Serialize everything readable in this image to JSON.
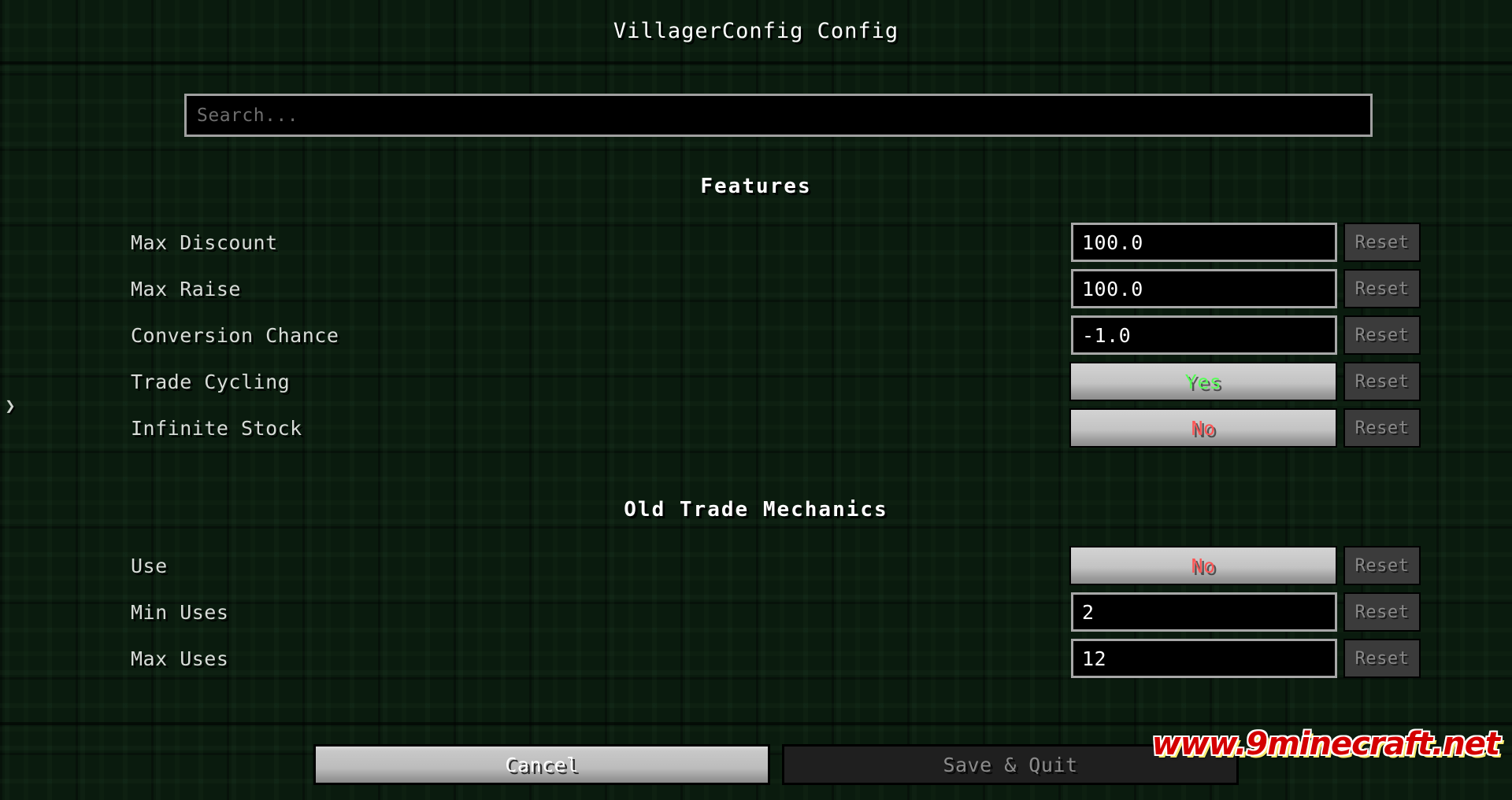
{
  "window": {
    "title": "VillagerConfig Config"
  },
  "left_tab": {
    "icon_glyph": "❯"
  },
  "search": {
    "value": "",
    "placeholder": "Search..."
  },
  "sections": [
    {
      "header": "Features",
      "rows": [
        {
          "label": "Max Discount",
          "control": "input",
          "value": "100.0",
          "reset_label": "Reset",
          "reset_enabled": false
        },
        {
          "label": "Max Raise",
          "control": "input",
          "value": "100.0",
          "reset_label": "Reset",
          "reset_enabled": false
        },
        {
          "label": "Conversion Chance",
          "control": "input",
          "value": "-1.0",
          "reset_label": "Reset",
          "reset_enabled": false
        },
        {
          "label": "Trade Cycling",
          "control": "toggle",
          "value": "Yes",
          "reset_label": "Reset",
          "reset_enabled": false
        },
        {
          "label": "Infinite Stock",
          "control": "toggle",
          "value": "No",
          "reset_label": "Reset",
          "reset_enabled": false
        }
      ]
    },
    {
      "header": "Old Trade Mechanics",
      "rows": [
        {
          "label": "Use",
          "control": "toggle",
          "value": "No",
          "reset_label": "Reset",
          "reset_enabled": false
        },
        {
          "label": "Min Uses",
          "control": "input",
          "value": "2",
          "reset_label": "Reset",
          "reset_enabled": false
        },
        {
          "label": "Max Uses",
          "control": "input",
          "value": "12",
          "reset_label": "Reset",
          "reset_enabled": false
        }
      ]
    }
  ],
  "footer": {
    "cancel_label": "Cancel",
    "save_label": "Save & Quit",
    "save_enabled": false
  },
  "watermark": {
    "text": "www.9minecraft.net"
  },
  "colors": {
    "background": "#0d2312",
    "toggle_yes": "#55ff55",
    "toggle_no": "#ff5555",
    "text_primary": "#ffffff",
    "text_label": "#d8dcd8",
    "text_disabled": "#8a8a8a",
    "input_bg": "#000000",
    "input_border": "#a8a8a8",
    "scrollbar": "#c6c6c6",
    "watermark_red": "#d40000"
  }
}
